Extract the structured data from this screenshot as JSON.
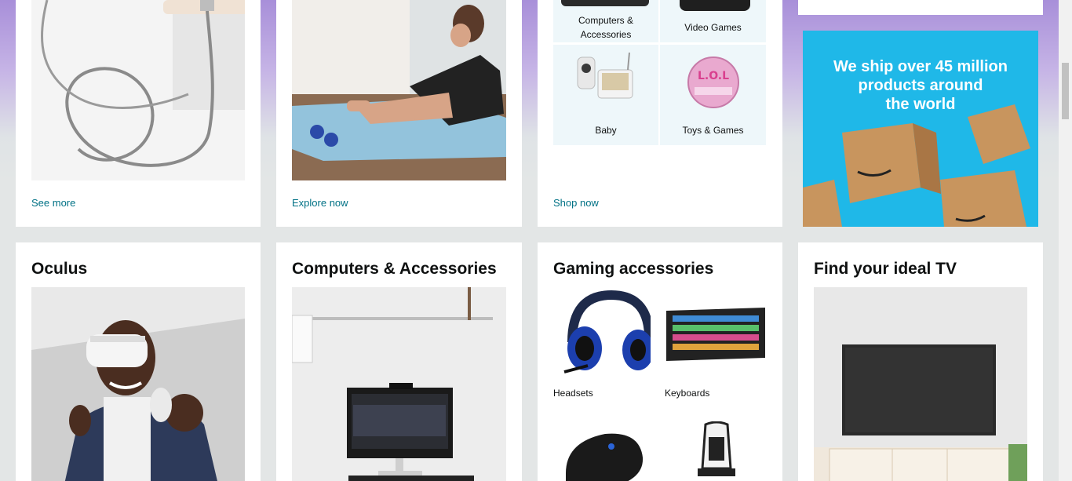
{
  "top_row": {
    "card1": {
      "link": "See more"
    },
    "card2": {
      "link": "Explore now"
    },
    "card3": {
      "link": "Shop now",
      "cells": [
        {
          "label": "Computers & Accessories"
        },
        {
          "label": "Video Games"
        },
        {
          "label": "Baby"
        },
        {
          "label": "Toys & Games"
        }
      ]
    },
    "ad": {
      "text_line1": "We ship over 45 million",
      "text_line2": "products around",
      "text_line3": "the world"
    }
  },
  "bottom_row": {
    "oculus": {
      "title": "Oculus"
    },
    "computers": {
      "title": "Computers & Accessories"
    },
    "gaming": {
      "title": "Gaming accessories",
      "cells": [
        {
          "label": "Headsets"
        },
        {
          "label": "Keyboards"
        },
        {
          "label": ""
        },
        {
          "label": ""
        }
      ]
    },
    "tv": {
      "title": "Find your ideal TV"
    }
  },
  "colors": {
    "link": "#007185",
    "ad_bg": "#1fb8e8",
    "text": "#0f1111"
  }
}
